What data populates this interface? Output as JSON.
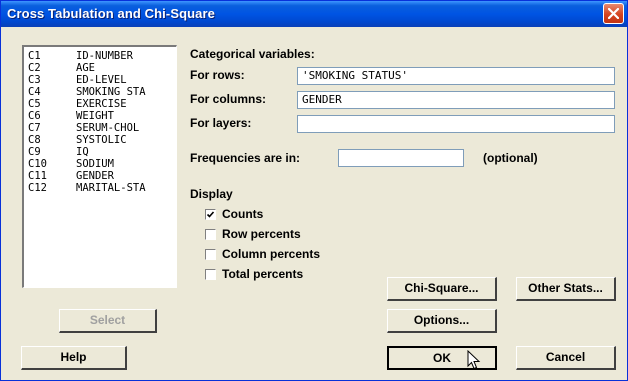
{
  "window": {
    "title": "Cross Tabulation and Chi-Square"
  },
  "variables": [
    {
      "col": "C1",
      "name": "ID-NUMBER"
    },
    {
      "col": "C2",
      "name": "AGE"
    },
    {
      "col": "C3",
      "name": "ED-LEVEL"
    },
    {
      "col": "C4",
      "name": "SMOKING STA"
    },
    {
      "col": "C5",
      "name": "EXERCISE"
    },
    {
      "col": "C6",
      "name": "WEIGHT"
    },
    {
      "col": "C7",
      "name": "SERUM-CHOL"
    },
    {
      "col": "C8",
      "name": "SYSTOLIC"
    },
    {
      "col": "C9",
      "name": "IQ"
    },
    {
      "col": "C10",
      "name": "SODIUM"
    },
    {
      "col": "C11",
      "name": "GENDER"
    },
    {
      "col": "C12",
      "name": "MARITAL-STA"
    }
  ],
  "categorical": {
    "heading": "Categorical variables:",
    "rows_label": "For rows:",
    "rows_value": "'SMOKING STATUS'",
    "columns_label": "For columns:",
    "columns_value": "GENDER",
    "layers_label": "For layers:",
    "layers_value": ""
  },
  "frequencies": {
    "label": "Frequencies are in:",
    "value": "",
    "optional": "(optional)"
  },
  "display": {
    "heading": "Display",
    "options": [
      {
        "label": "Counts",
        "checked": true
      },
      {
        "label": "Row percents",
        "checked": false
      },
      {
        "label": "Column percents",
        "checked": false
      },
      {
        "label": "Total percents",
        "checked": false
      }
    ]
  },
  "buttons": {
    "select": "Select",
    "help": "Help",
    "chi_square": "Chi-Square...",
    "other_stats": "Other Stats...",
    "options": "Options...",
    "ok": "OK",
    "cancel": "Cancel"
  },
  "icons": {
    "close": "close-icon",
    "check": "check-icon",
    "cursor": "mouse-pointer-icon"
  }
}
